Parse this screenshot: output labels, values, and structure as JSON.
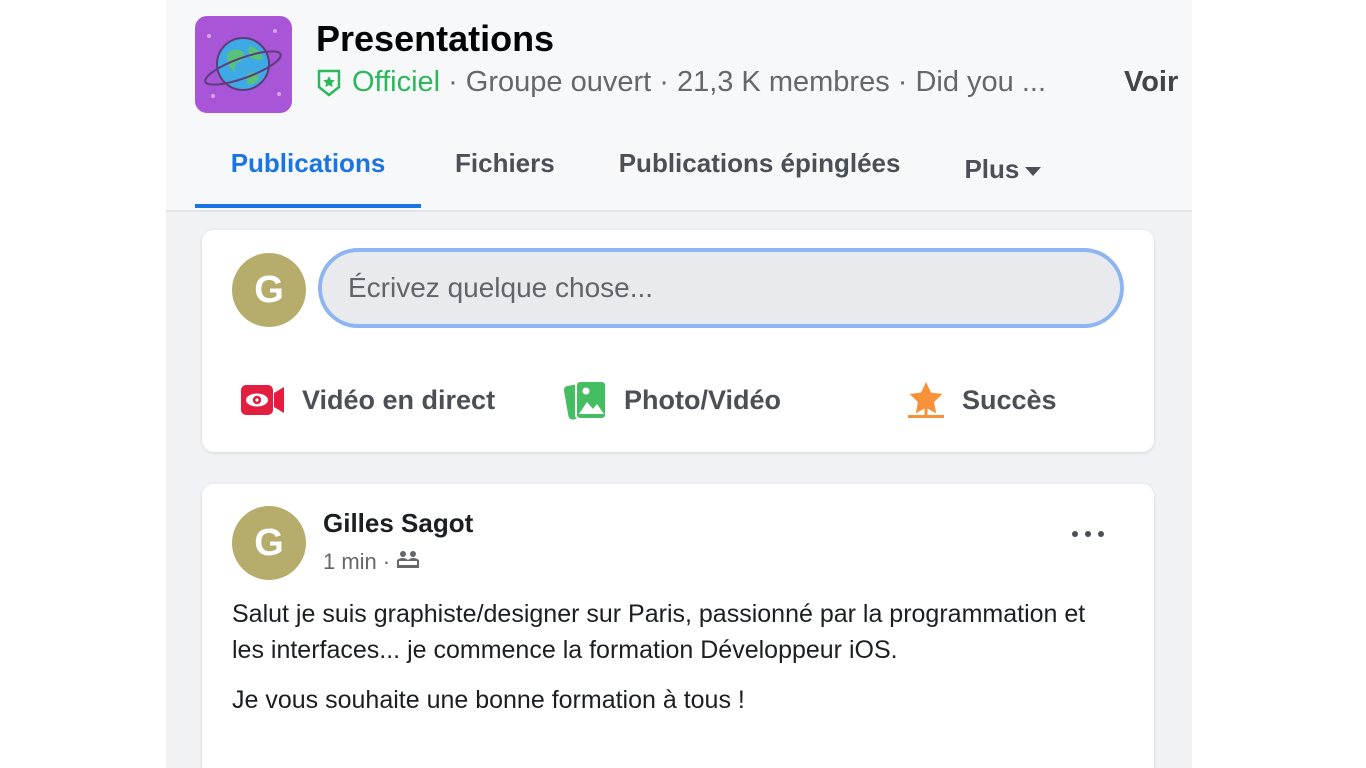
{
  "group": {
    "title": "Presentations",
    "official": "Officiel",
    "meta_text": "Groupe ouvert · 21,3 K membres · Did you ...",
    "voir": "Voir"
  },
  "tabs": [
    {
      "label": "Publications",
      "active": true
    },
    {
      "label": "Fichiers",
      "active": false
    },
    {
      "label": "Publications épinglées",
      "active": false
    },
    {
      "label": "Plus",
      "active": false
    }
  ],
  "composer": {
    "avatar_letter": "G",
    "placeholder": "Écrivez quelque chose...",
    "actions": [
      {
        "label": "Vidéo en direct",
        "icon": "live-video-icon",
        "color": "#e41e3f"
      },
      {
        "label": "Photo/Vidéo",
        "icon": "photo-icon",
        "color": "#45bd62"
      },
      {
        "label": "Succès",
        "icon": "star-icon",
        "color": "#f7923b"
      }
    ]
  },
  "post": {
    "avatar_letter": "G",
    "author": "Gilles Sagot",
    "time": "1 min",
    "privacy_icon": "group-privacy-icon",
    "paragraphs": [
      "Salut je suis graphiste/designer sur Paris, passionné par la programmation et les interfaces... je commence la formation Développeur iOS.",
      "Je vous souhaite une bonne formation à tous !"
    ]
  },
  "colors": {
    "accent": "#1b74e4",
    "official": "#2bb85a",
    "avatar": "#b6ad6c",
    "group_logo": "#a855d7"
  }
}
